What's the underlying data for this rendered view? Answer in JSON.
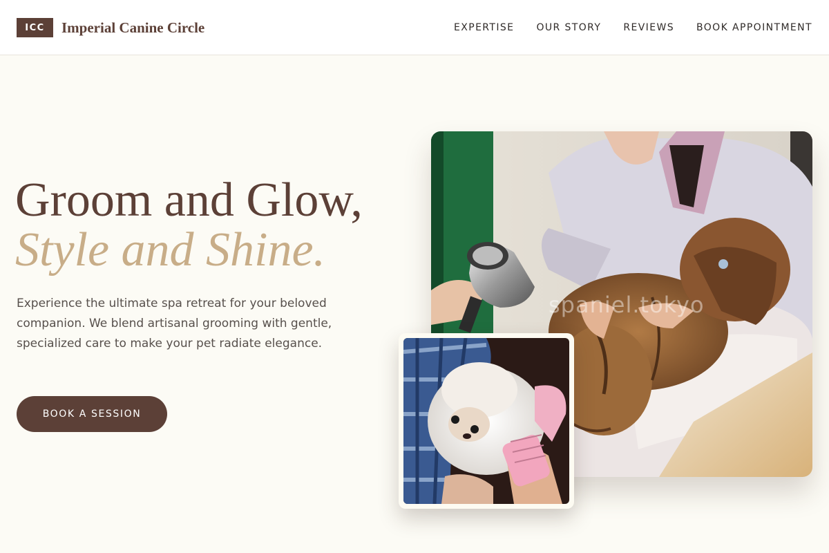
{
  "header": {
    "logo_badge": "ICC",
    "brand_name": "Imperial Canine Circle",
    "nav": [
      {
        "label": "EXPERTISE"
      },
      {
        "label": "OUR STORY"
      },
      {
        "label": "REVIEWS"
      },
      {
        "label": "BOOK APPOINTMENT"
      }
    ]
  },
  "hero": {
    "headline_line1": "Groom and Glow,",
    "headline_line2": "Style and Shine.",
    "description": "Experience the ultimate spa retreat for your beloved companion. We blend artisanal grooming with gentle, specialized care to make your pet radiate elegance.",
    "cta_label": "BOOK A SESSION",
    "main_image": {
      "watermark": "spaniel.tokyo"
    }
  },
  "colors": {
    "brand_brown": "#5c4037",
    "accent_gold": "#c8ad88",
    "page_bg": "#fcfbf5"
  }
}
